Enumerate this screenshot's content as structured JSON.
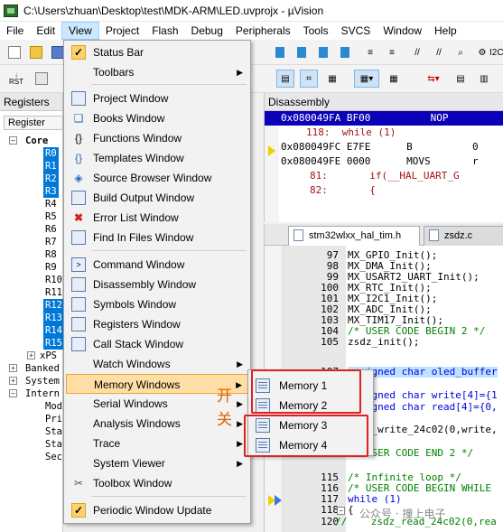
{
  "window": {
    "title": "C:\\Users\\zhuan\\Desktop\\test\\MDK-ARM\\LED.uvprojx - µVision"
  },
  "menubar": [
    "File",
    "Edit",
    "View",
    "Project",
    "Flash",
    "Debug",
    "Peripherals",
    "Tools",
    "SVCS",
    "Window",
    "Help"
  ],
  "toolbar": {
    "rst_label": "RST",
    "i2c_label": "I2C"
  },
  "registers_panel": {
    "title": "Registers",
    "header": "Register",
    "core_label": "Core",
    "rows": [
      "R0",
      "R1",
      "R2",
      "R3",
      "R4",
      "R5",
      "R6",
      "R7",
      "R8",
      "R9",
      "R10",
      "R11",
      "R12",
      "R13",
      "R14",
      "R15",
      "xPS"
    ],
    "groups": [
      "Banked",
      "System",
      "Intern"
    ],
    "sub_items": [
      "Mod",
      "Pri",
      "Sta",
      "Sta",
      "Sec"
    ]
  },
  "disassembly": {
    "title": "Disassembly",
    "lines": [
      {
        "addr": "0x080049FA",
        "op": "BF00",
        "mn": "NOP",
        "arg": ""
      },
      {
        "num": "118:",
        "src": "while (1)"
      },
      {
        "addr": "0x080049FC",
        "op": "E7FE",
        "mn": "B",
        "arg": "0"
      },
      {
        "addr": "0x080049FE",
        "op": "0000",
        "mn": "MOVS",
        "arg": "r"
      },
      {
        "num": "81:",
        "src": "if(__HAL_UART_G"
      },
      {
        "num": "82:",
        "src": "{"
      }
    ]
  },
  "editor": {
    "tabs": [
      "stm32wlxx_hal_tim.h",
      "zsdz.c"
    ],
    "lines": [
      {
        "n": "97",
        "code": "MX_GPIO_Init();"
      },
      {
        "n": "98",
        "code": "MX_DMA_Init();"
      },
      {
        "n": "99",
        "code": "MX_USART2_UART_Init();"
      },
      {
        "n": "100",
        "code": "MX_RTC_Init();"
      },
      {
        "n": "101",
        "code": "MX_I2C1_Init();"
      },
      {
        "n": "102",
        "code": "MX_ADC_Init();"
      },
      {
        "n": "103",
        "code": "MX_TIM17_Init();"
      },
      {
        "n": "104",
        "code": "/* USER CODE BEGIN 2 */"
      },
      {
        "n": "105",
        "code": "zsdz_init();"
      },
      {
        "n": "107",
        "code": "unsigned char oled_buffer"
      },
      {
        "n": "108",
        "code": "unsigned char write[4]={1"
      },
      {
        "n": "109",
        "code": "unsigned char read[4]={0,"
      },
      {
        "n": "111",
        "code": "zsdz_write_24c02(0,write,"
      },
      {
        "n": "113",
        "code": "/* USER CODE END 2 */"
      },
      {
        "n": "115",
        "code": "/* Infinite loop */"
      },
      {
        "n": "116",
        "code": "/* USER CODE BEGIN WHILE"
      },
      {
        "n": "117",
        "code": "while (1)"
      },
      {
        "n": "118",
        "code": "{"
      },
      {
        "n": "120",
        "code": "//    zsdz_read_24c02(0,rea"
      }
    ]
  },
  "view_menu": {
    "items": [
      {
        "label": "Status Bar",
        "icon": "check-icon",
        "checked": true
      },
      {
        "label": "Toolbars",
        "icon": "",
        "submenu": true
      },
      {
        "label": "Project Window",
        "icon": "project-window-icon"
      },
      {
        "label": "Books Window",
        "icon": "books-icon"
      },
      {
        "label": "Functions Window",
        "icon": "functions-icon"
      },
      {
        "label": "Templates Window",
        "icon": "templates-icon"
      },
      {
        "label": "Source Browser Window",
        "icon": "source-browser-icon"
      },
      {
        "label": "Build Output Window",
        "icon": "build-output-icon"
      },
      {
        "label": "Error List Window",
        "icon": "error-icon"
      },
      {
        "label": "Find In Files Window",
        "icon": "find-in-files-icon"
      },
      {
        "label": "Command Window",
        "icon": "command-icon"
      },
      {
        "label": "Disassembly Window",
        "icon": "disassembly-icon"
      },
      {
        "label": "Symbols Window",
        "icon": "symbols-icon"
      },
      {
        "label": "Registers Window",
        "icon": "registers-icon"
      },
      {
        "label": "Call Stack Window",
        "icon": "call-stack-icon"
      },
      {
        "label": "Watch Windows",
        "icon": "",
        "submenu": true
      },
      {
        "label": "Memory Windows",
        "icon": "",
        "submenu": true,
        "highlighted": true
      },
      {
        "label": "Serial Windows",
        "icon": "",
        "submenu": true
      },
      {
        "label": "Analysis Windows",
        "icon": "",
        "submenu": true
      },
      {
        "label": "Trace",
        "icon": "",
        "submenu": true
      },
      {
        "label": "System Viewer",
        "icon": "",
        "submenu": true
      },
      {
        "label": "Toolbox Window",
        "icon": "toolbox-icon"
      },
      {
        "label": "Periodic Window Update",
        "icon": "check-icon",
        "checked": true
      }
    ]
  },
  "memory_submenu": {
    "items": [
      "Memory 1",
      "Memory 2",
      "Memory 3",
      "Memory 4"
    ]
  },
  "annotation": {
    "line1": "开",
    "line2": "关",
    "color": "#e06000"
  },
  "watermark": "公众号 · 撞上电子"
}
